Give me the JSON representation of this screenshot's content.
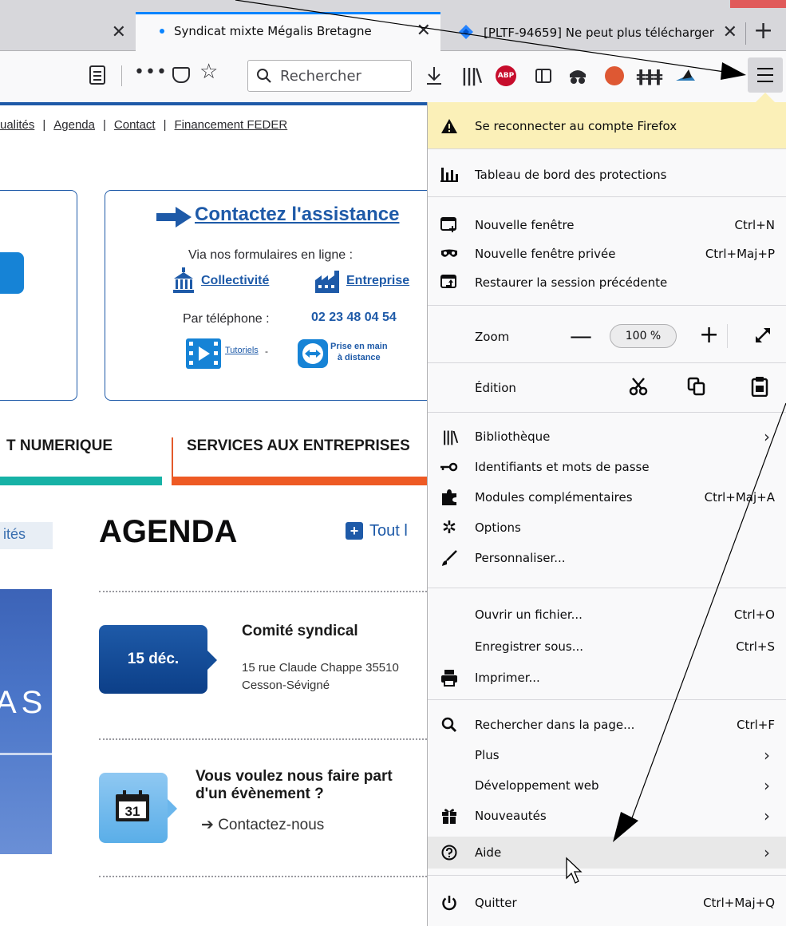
{
  "browser": {
    "tabs": [
      {
        "title": "Syndicat mixte Mégalis Bretagne"
      },
      {
        "title": "[PLTF-94659] Ne peut plus télécharger"
      }
    ],
    "search_placeholder": "Rechercher",
    "accent_color": "#0a84ff"
  },
  "page": {
    "top_links": [
      "ualités",
      "Agenda",
      "Contact",
      "Financement FEDER"
    ],
    "contact": {
      "title": "Contactez l'assistance",
      "via": "Via nos formulaires en ligne :",
      "collectivite": "Collectivité",
      "entreprise": "Entreprise",
      "phone_label": "Par téléphone :",
      "phone_number": "02 23 48 04 54",
      "tutoriels": "Tutoriels",
      "dash": "-",
      "prise_line1": "Prise en main",
      "prise_line2": "à distance"
    },
    "nav_tabs": [
      "T NUMERIQUE",
      "SERVICES AUX ENTREPRISES"
    ],
    "tag": "ités",
    "agenda_title": "AGENDA",
    "agenda_all": "Tout l",
    "side_letters": "AS",
    "event": {
      "date": "15 déc.",
      "title": "Comité syndical",
      "address_line1": "15 rue Claude Chappe 35510",
      "address_line2": "Cesson-Sévigné"
    },
    "cta": {
      "calendar_day": "31",
      "title": "Vous voulez nous faire part d'un évènement ?",
      "link": "➔ Contactez-nous"
    }
  },
  "menu": {
    "reconnect": "Se reconnecter au compte Firefox",
    "protections": "Tableau de bord des protections",
    "new_window": {
      "label": "Nouvelle fenêtre",
      "shortcut": "Ctrl+N"
    },
    "private_window": {
      "label": "Nouvelle fenêtre privée",
      "shortcut": "Ctrl+Maj+P"
    },
    "restore_session": "Restaurer la session précédente",
    "zoom": {
      "label": "Zoom",
      "value": "100 %",
      "minus": "—",
      "plus": "+"
    },
    "edition": "Édition",
    "library": "Bibliothèque",
    "logins": "Identifiants et mots de passe",
    "addons": {
      "label": "Modules complémentaires",
      "shortcut": "Ctrl+Maj+A"
    },
    "options": "Options",
    "customize": "Personnaliser...",
    "open_file": {
      "label": "Ouvrir un fichier...",
      "shortcut": "Ctrl+O"
    },
    "save_as": {
      "label": "Enregistrer sous...",
      "shortcut": "Ctrl+S"
    },
    "print": "Imprimer...",
    "find": {
      "label": "Rechercher dans la page...",
      "shortcut": "Ctrl+F"
    },
    "more": "Plus",
    "web_dev": "Développement web",
    "whats_new": "Nouveautés",
    "help": "Aide",
    "quit": {
      "label": "Quitter",
      "shortcut": "Ctrl+Maj+Q"
    }
  }
}
